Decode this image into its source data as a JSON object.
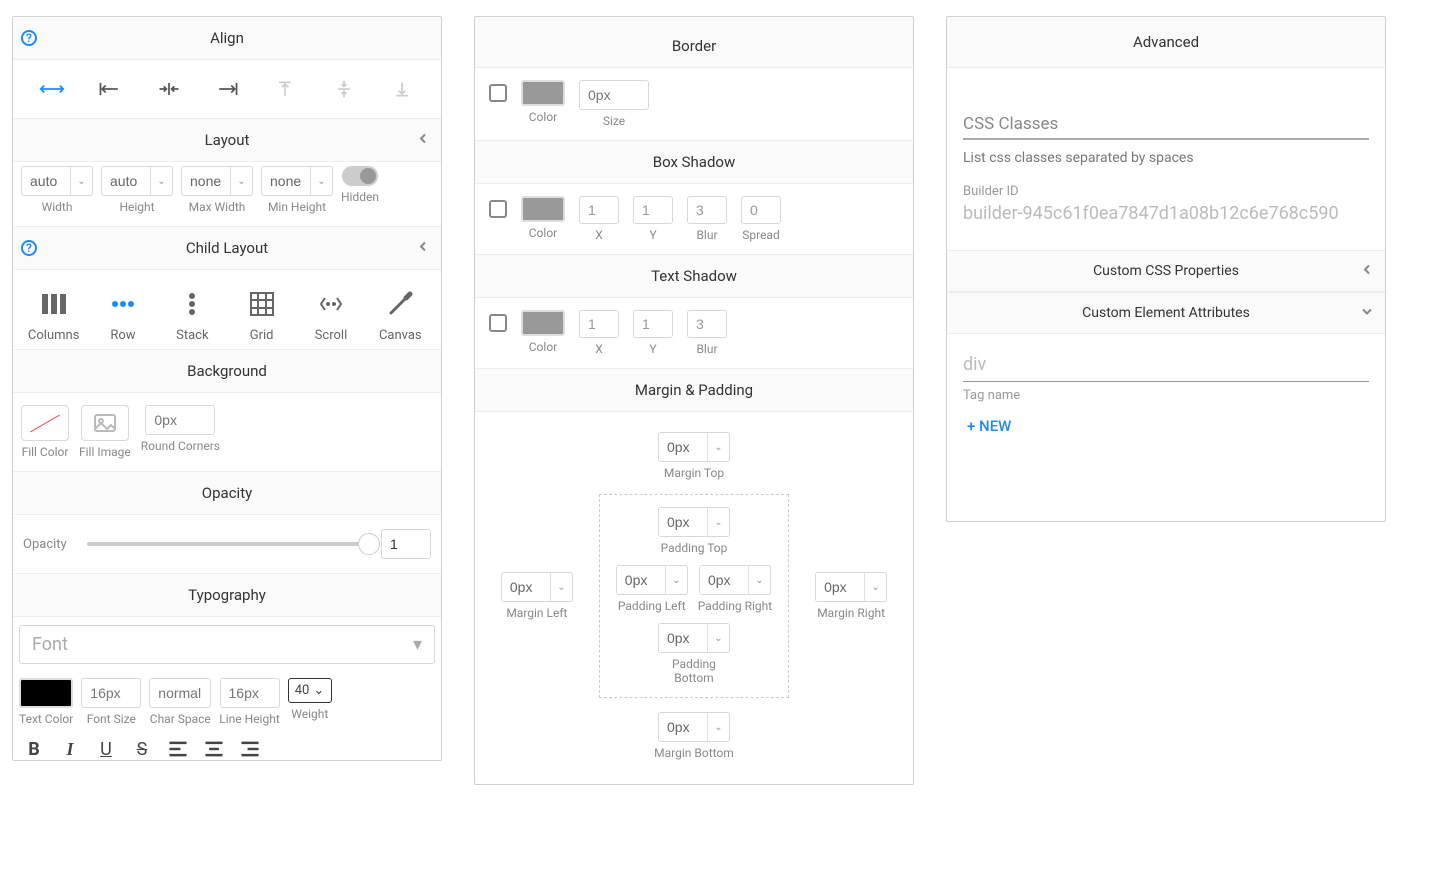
{
  "panel1": {
    "align": {
      "title": "Align"
    },
    "layout": {
      "title": "Layout",
      "width_value": "auto",
      "width_label": "Width",
      "height_value": "auto",
      "height_label": "Height",
      "maxwidth_value": "none",
      "maxwidth_label": "Max Width",
      "minheight_value": "none",
      "minheight_label": "Min Height",
      "hidden_label": "Hidden"
    },
    "childlayout": {
      "title": "Child Layout",
      "items": [
        "Columns",
        "Row",
        "Stack",
        "Grid",
        "Scroll",
        "Canvas"
      ]
    },
    "background": {
      "title": "Background",
      "fillcolor": "Fill Color",
      "fillimage": "Fill Image",
      "roundcorners_label": "Round Corners",
      "roundcorners_value": "0px"
    },
    "opacity": {
      "title": "Opacity",
      "label": "Opacity",
      "value": "1"
    },
    "typography": {
      "title": "Typography",
      "font_placeholder": "Font",
      "textcolor": "Text Color",
      "fontsize_value": "16px",
      "fontsize_label": "Font Size",
      "charspace_value": "normal",
      "charspace_label": "Char Space",
      "lineheight_value": "16px",
      "lineheight_label": "Line Height",
      "weight_value": "40",
      "weight_label": "Weight"
    }
  },
  "panel2": {
    "border": {
      "title": "Border",
      "color_label": "Color",
      "size_placeholder": "0px",
      "size_label": "Size"
    },
    "boxshadow": {
      "title": "Box Shadow",
      "color_label": "Color",
      "x_value": "1",
      "x_label": "X",
      "y_value": "1",
      "y_label": "Y",
      "blur_value": "3",
      "blur_label": "Blur",
      "spread_value": "0",
      "spread_label": "Spread"
    },
    "textshadow": {
      "title": "Text Shadow",
      "color_label": "Color",
      "x_value": "1",
      "x_label": "X",
      "y_value": "1",
      "y_label": "Y",
      "blur_value": "3",
      "blur_label": "Blur"
    },
    "margin_padding": {
      "title": "Margin & Padding",
      "margin_top": {
        "value": "0px",
        "label": "Margin Top"
      },
      "padding_top": {
        "value": "0px",
        "label": "Padding Top"
      },
      "margin_left": {
        "value": "0px",
        "label": "Margin Left"
      },
      "padding_left": {
        "value": "0px",
        "label": "Padding Left"
      },
      "padding_right": {
        "value": "0px",
        "label": "Padding Right"
      },
      "margin_right": {
        "value": "0px",
        "label": "Margin Right"
      },
      "padding_bottom": {
        "value": "0px",
        "label": "Padding Bottom"
      },
      "margin_bottom": {
        "value": "0px",
        "label": "Margin Bottom"
      }
    }
  },
  "panel3": {
    "title": "Advanced",
    "css_classes_label": "CSS Classes",
    "css_classes_hint": "List css classes separated by spaces",
    "builder_id_label": "Builder ID",
    "builder_id_value": "builder-945c61f0ea7847d1a08b12c6e768c590",
    "custom_css_title": "Custom CSS Properties",
    "custom_attr_title": "Custom Element Attributes",
    "tagname_value": "div",
    "tagname_label": "Tag name",
    "new_label": "+ NEW"
  }
}
